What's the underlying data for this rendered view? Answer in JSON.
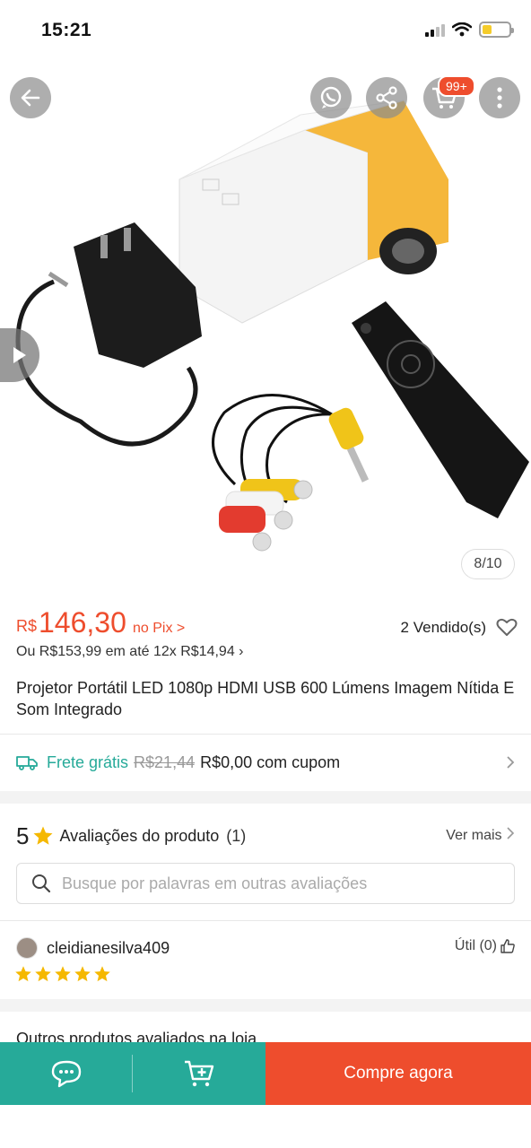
{
  "status_bar": {
    "time": "15:21"
  },
  "gallery": {
    "counter": "8/10",
    "cart_badge": "99+"
  },
  "price": {
    "currency": "R$",
    "value": "146,30",
    "pix_label": "no Pix >",
    "sold": "2 Vendido(s)",
    "installments": "Ou R$153,99 em até 12x R$14,94 ›"
  },
  "product": {
    "title": "Projetor Portátil LED 1080p HDMI USB 600 Lúmens Imagem Nítida E Som Integrado"
  },
  "shipping": {
    "free_label": "Frete grátis",
    "old_price": "R$21,44",
    "coupon_text": "R$0,00 com cupom"
  },
  "reviews": {
    "rating": "5",
    "title": "Avaliações do produto",
    "count": "(1)",
    "see_more": "Ver mais",
    "search_placeholder": "Busque por palavras em outras avaliações",
    "reviewer_name": "cleidianesilva409",
    "useful": "Útil (0)",
    "stars": 5
  },
  "other_products": "Outros produtos avaliados na loja",
  "bottom_bar": {
    "buy_now": "Compre agora"
  },
  "colors": {
    "accent": "#ee4d2d",
    "teal": "#26aa99",
    "star": "#f5b800"
  },
  "icons": [
    "back-arrow-icon",
    "whatsapp-icon",
    "share-icon",
    "cart-icon",
    "more-icon",
    "play-icon",
    "heart-icon",
    "truck-icon",
    "chevron-right-icon",
    "star-icon",
    "search-icon",
    "thumbs-up-icon",
    "chat-icon",
    "add-to-cart-icon"
  ]
}
